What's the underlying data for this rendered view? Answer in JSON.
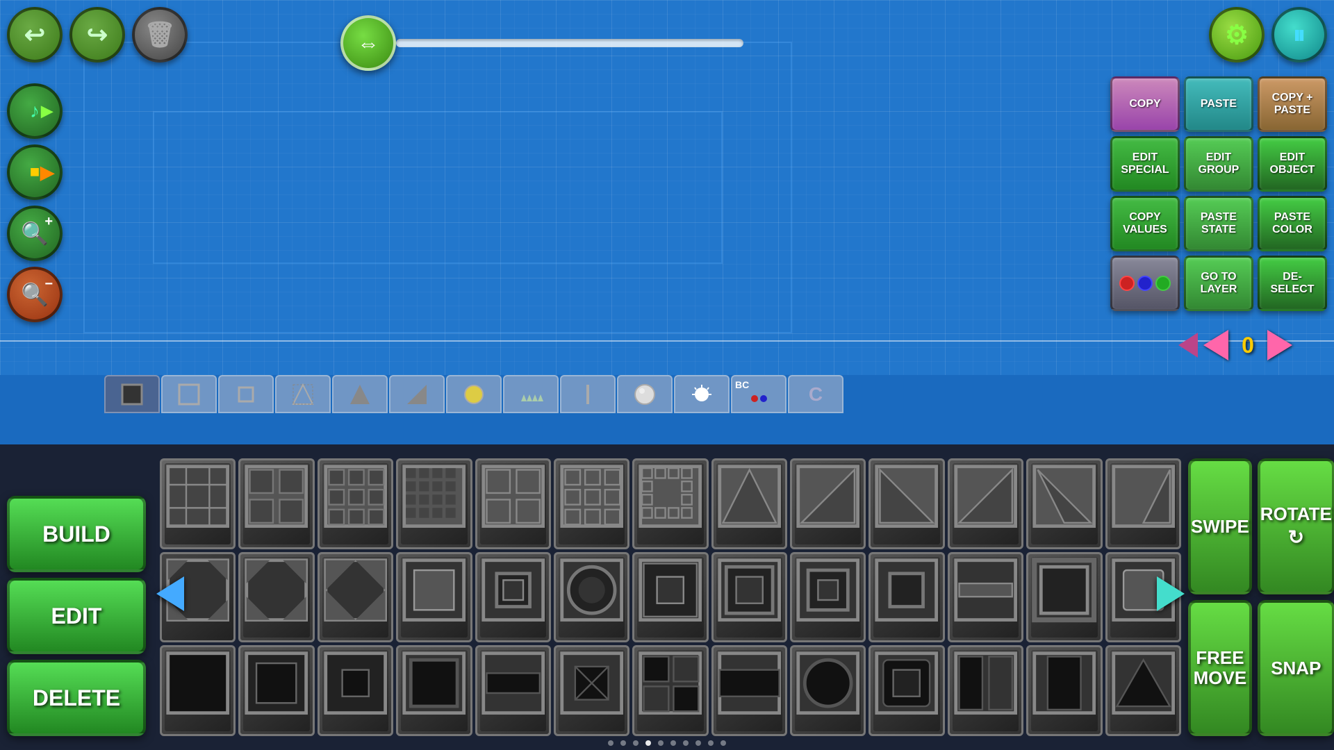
{
  "toolbar": {
    "undo_label": "↩",
    "redo_label": "↪",
    "delete_label": "🗑",
    "gear_label": "⚙",
    "pause_label": "⏸"
  },
  "slider": {
    "value": 0
  },
  "layer": {
    "current": "0",
    "prev_arrow": "◀",
    "next_arrow": "▶"
  },
  "right_panel": {
    "copy_label": "COPY",
    "paste_label": "PASTE",
    "copy_paste_label": "COPY + PASTE",
    "edit_special_label": "EDIT SPECIAL",
    "edit_group_label": "EDIT GROUP",
    "edit_object_label": "EDIT OBJECT",
    "copy_values_label": "COPY VALUES",
    "paste_state_label": "PASTE STATE",
    "paste_color_label": "PASTE COLOR",
    "go_to_layer_label": "GO TO LAYER",
    "deselect_label": "DE- SELECT"
  },
  "mode_buttons": {
    "build_label": "BUILD",
    "edit_label": "EDIT",
    "delete_label": "DELETE"
  },
  "action_buttons": {
    "swipe_label": "SWIPE",
    "rotate_label": "ROTATE",
    "free_move_label": "FREE MOVE",
    "snap_label": "SNAP"
  },
  "dots": [
    1,
    2,
    3,
    4,
    5,
    6,
    7,
    8,
    9,
    10
  ],
  "active_dot": 4
}
